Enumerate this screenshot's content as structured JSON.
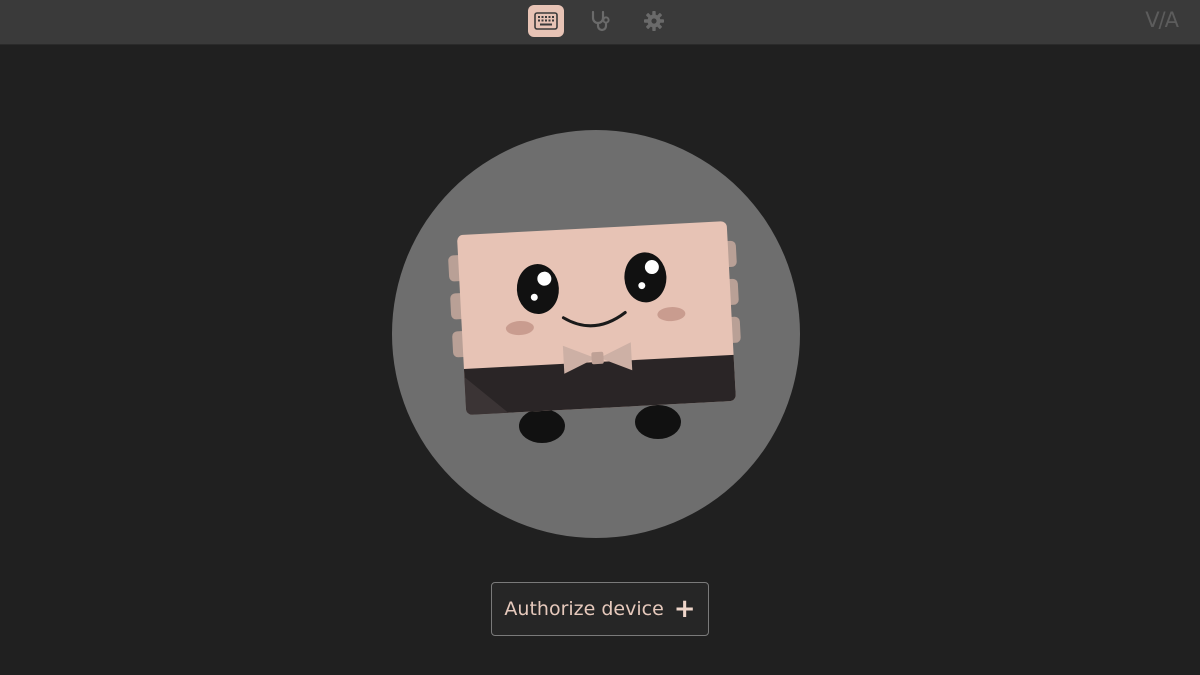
{
  "topbar": {
    "brand": "V/A",
    "nav": [
      {
        "name": "keyboard",
        "active": true
      },
      {
        "name": "stethoscope",
        "active": false
      },
      {
        "name": "settings",
        "active": false
      }
    ]
  },
  "main": {
    "authorize_label": "Authorize device",
    "authorize_icon": "+"
  },
  "colors": {
    "accent": "#e7c3b5",
    "background": "#202020",
    "topbar": "#3a3a3a",
    "circle": "#6e6e6e"
  }
}
